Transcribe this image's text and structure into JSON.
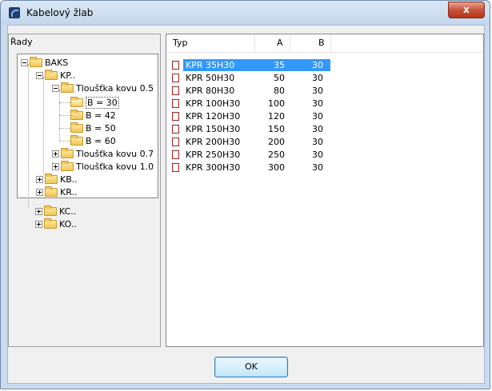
{
  "window": {
    "title": "Kabelový žlab",
    "close_label": "x"
  },
  "left_panel": {
    "label": "Řady",
    "tree": [
      {
        "label": "BAKS"
      },
      {
        "label": "KP.."
      },
      {
        "label": "Tloušťka kovu 0.5"
      },
      {
        "label": "B = 30"
      },
      {
        "label": "B = 42"
      },
      {
        "label": "B = 50"
      },
      {
        "label": "B = 60"
      },
      {
        "label": "Tloušťka kovu 0.7"
      },
      {
        "label": "Tloušťka kovu 1.0"
      },
      {
        "label": "KB.."
      },
      {
        "label": "KR.."
      },
      {
        "label": "KC.."
      },
      {
        "label": "KO.."
      }
    ]
  },
  "right_panel": {
    "columns": [
      "Typ",
      "A",
      "B"
    ],
    "rows": [
      {
        "typ": "KPR 35H30",
        "a": "35",
        "b": "30"
      },
      {
        "typ": "KPR 50H30",
        "a": "50",
        "b": "30"
      },
      {
        "typ": "KPR 80H30",
        "a": "80",
        "b": "30"
      },
      {
        "typ": "KPR 100H30",
        "a": "100",
        "b": "30"
      },
      {
        "typ": "KPR 120H30",
        "a": "120",
        "b": "30"
      },
      {
        "typ": "KPR 150H30",
        "a": "150",
        "b": "30"
      },
      {
        "typ": "KPR 200H30",
        "a": "200",
        "b": "30"
      },
      {
        "typ": "KPR 250H30",
        "a": "250",
        "b": "30"
      },
      {
        "typ": "KPR 300H30",
        "a": "300",
        "b": "30"
      }
    ]
  },
  "footer": {
    "ok_label": "OK"
  }
}
